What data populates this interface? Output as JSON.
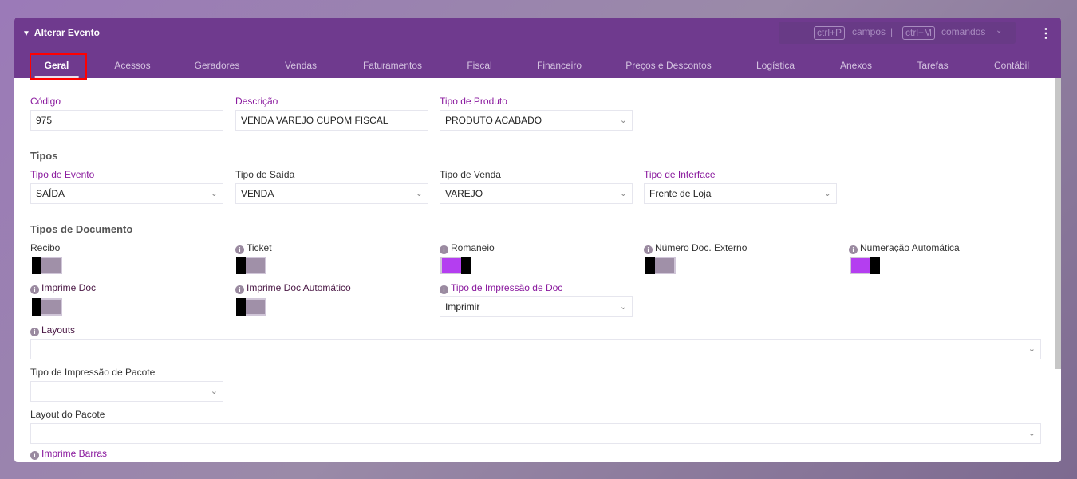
{
  "window": {
    "title": "Alterar Evento"
  },
  "command_bar": {
    "fields_shortcut": "ctrl+P",
    "fields_label": "campos",
    "separator": "|",
    "commands_shortcut": "ctrl+M",
    "commands_label": "comandos"
  },
  "tabs": [
    {
      "label": "Geral",
      "active": true
    },
    {
      "label": "Acessos"
    },
    {
      "label": "Geradores"
    },
    {
      "label": "Vendas"
    },
    {
      "label": "Faturamentos"
    },
    {
      "label": "Fiscal"
    },
    {
      "label": "Financeiro"
    },
    {
      "label": "Preços e Descontos"
    },
    {
      "label": "Logística"
    },
    {
      "label": "Anexos"
    },
    {
      "label": "Tarefas"
    },
    {
      "label": "Contábil"
    }
  ],
  "form": {
    "codigo": {
      "label": "Código",
      "value": "975"
    },
    "descricao": {
      "label": "Descrição",
      "value": "VENDA VAREJO CUPOM FISCAL"
    },
    "tipo_produto": {
      "label": "Tipo de Produto",
      "value": "PRODUTO ACABADO"
    },
    "tipos_title": "Tipos",
    "tipo_evento": {
      "label": "Tipo de Evento",
      "value": "SAÍDA"
    },
    "tipo_saida": {
      "label": "Tipo de Saída",
      "value": "VENDA"
    },
    "tipo_venda": {
      "label": "Tipo de Venda",
      "value": "VAREJO"
    },
    "tipo_interface": {
      "label": "Tipo de Interface",
      "value": "Frente de Loja"
    },
    "docs_title": "Tipos de Documento",
    "recibo": {
      "label": "Recibo",
      "on": false
    },
    "ticket": {
      "label": "Ticket",
      "on": false
    },
    "romaneio": {
      "label": "Romaneio",
      "on": true
    },
    "numero_doc_externo": {
      "label": "Número Doc. Externo",
      "on": false
    },
    "numeracao_automatica": {
      "label": "Numeração Automática",
      "on": true
    },
    "imprime_doc": {
      "label": "Imprime Doc",
      "on": false
    },
    "imprime_doc_auto": {
      "label": "Imprime Doc Automático",
      "on": false
    },
    "tipo_impressao_doc": {
      "label": "Tipo de Impressão de Doc",
      "value": "Imprimir"
    },
    "layouts": {
      "label": "Layouts",
      "value": ""
    },
    "tipo_impressao_pacote": {
      "label": "Tipo de Impressão de Pacote",
      "value": ""
    },
    "layout_pacote": {
      "label": "Layout do Pacote",
      "value": ""
    },
    "imprime_barras": {
      "label": "Imprime Barras"
    }
  }
}
